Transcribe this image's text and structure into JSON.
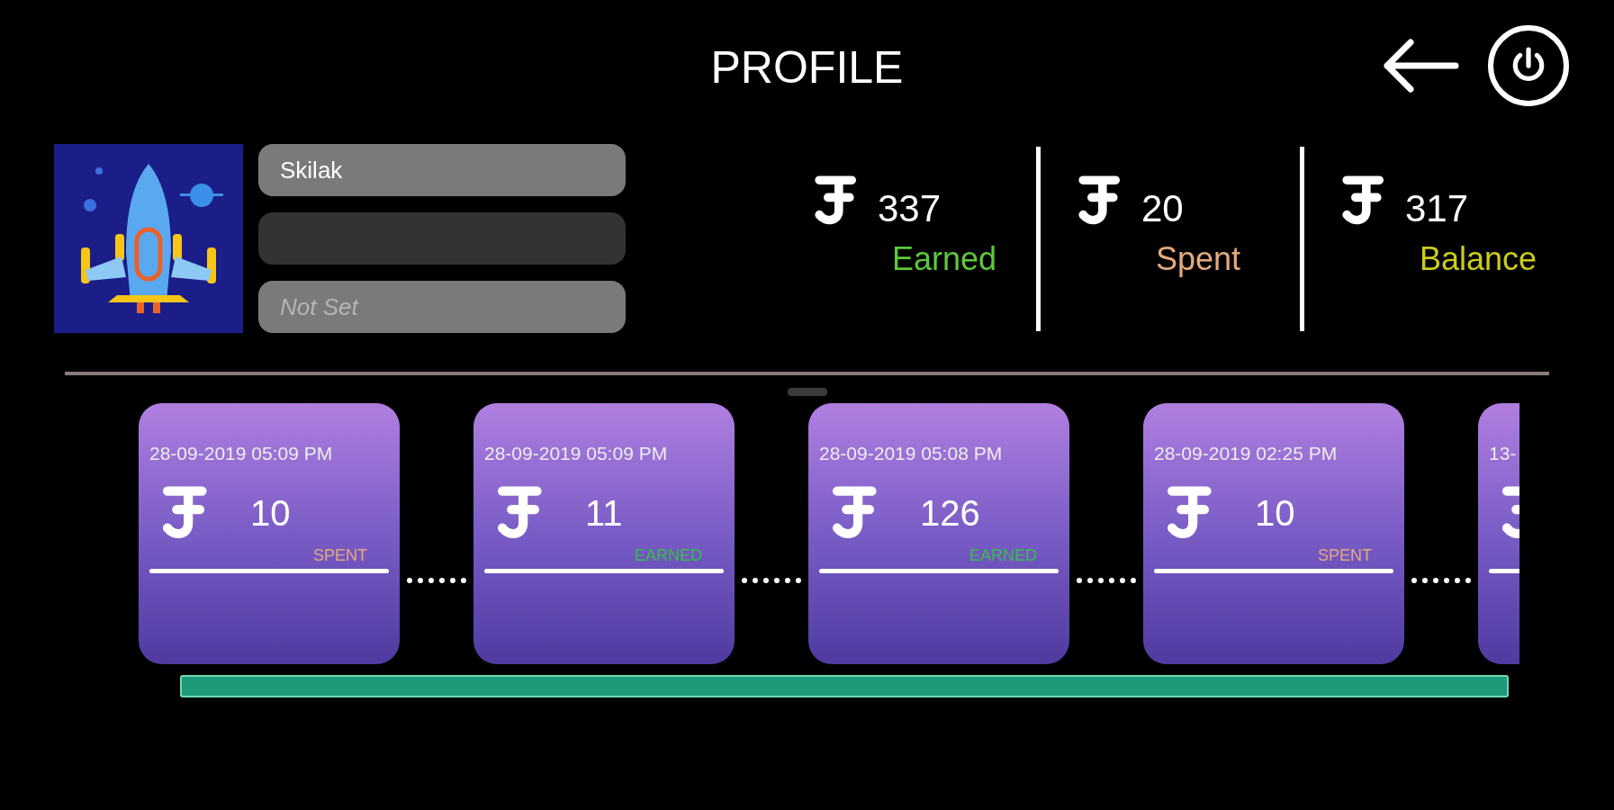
{
  "header": {
    "title": "PROFILE"
  },
  "profile": {
    "fields": [
      {
        "value": "Skilak",
        "disabled": false
      },
      {
        "disabled": true
      },
      {
        "placeholder": "Not Set",
        "disabled": false
      }
    ]
  },
  "stats": [
    {
      "amount": "337",
      "label": "Earned",
      "color": "#5cc93a"
    },
    {
      "amount": "20",
      "label": "Spent",
      "color": "#e3aa7d"
    },
    {
      "amount": "317",
      "label": "Balance",
      "color": "#cccc1c"
    }
  ],
  "transactions": [
    {
      "date": "28-09-2019 05:09 PM",
      "amount": "10",
      "label": "SPENT",
      "kind": "spent"
    },
    {
      "date": "28-09-2019 05:09 PM",
      "amount": "11",
      "label": "EARNED",
      "kind": "earned"
    },
    {
      "date": "28-09-2019 05:08 PM",
      "amount": "126",
      "label": "EARNED",
      "kind": "earned"
    },
    {
      "date": "28-09-2019 02:25 PM",
      "amount": "10",
      "label": "SPENT",
      "kind": "spent"
    },
    {
      "date": "13-"
    }
  ]
}
